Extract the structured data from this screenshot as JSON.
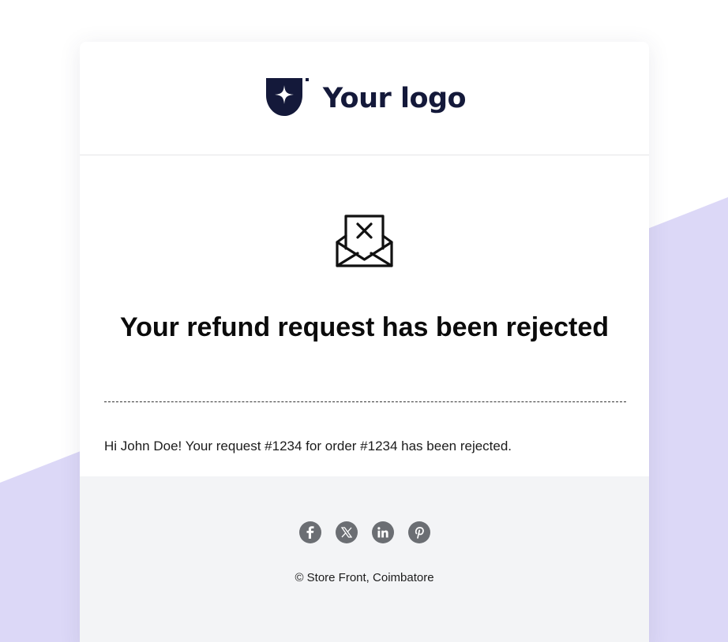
{
  "colors": {
    "page_background": "#ffffff",
    "background_accent": "#dcd8f7",
    "card_background": "#ffffff",
    "footer_background": "#f3f4f6",
    "logo_color": "#14193a",
    "social_icon_background": "#6b6e73"
  },
  "header": {
    "logo_icon": "logo-mark-icon",
    "logo_text": "Your logo"
  },
  "main": {
    "icon": "envelope-x-icon",
    "title": "Your refund request has been rejected",
    "message": "Hi John Doe! Your request #1234 for order #1234 has been rejected."
  },
  "footer": {
    "social_icons": [
      "facebook-icon",
      "x-icon",
      "linkedin-icon",
      "pinterest-icon"
    ],
    "copyright": "© Store Front, Coimbatore"
  }
}
